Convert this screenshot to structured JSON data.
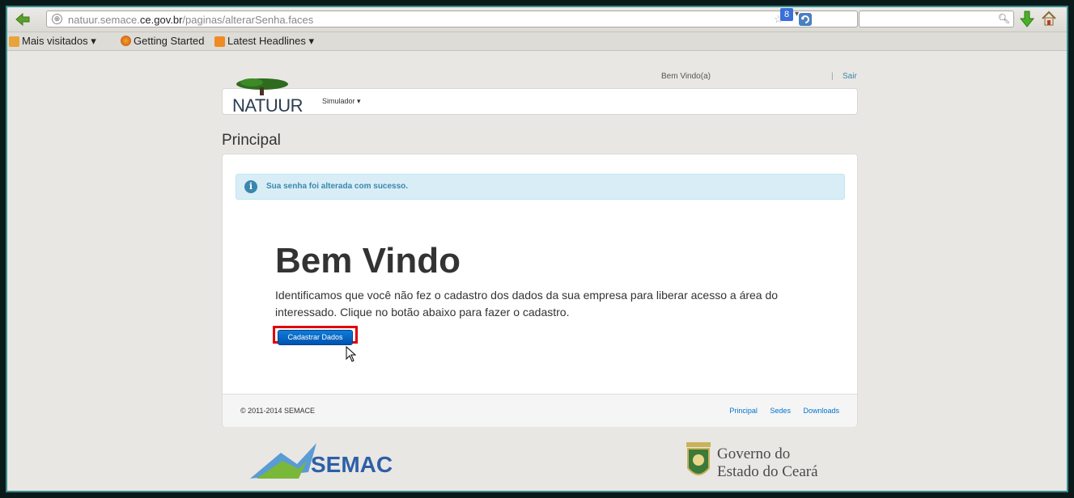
{
  "browser": {
    "url_prefix": "natuur.semace.",
    "url_domain": "ce.gov.br",
    "url_path": "/paginas/alterarSenha.faces",
    "search_engine_label": "8",
    "bookmarks": [
      {
        "label": "Mais visitados ▾",
        "icon": "folder-icon"
      },
      {
        "label": "Getting Started",
        "icon": "firefox-icon"
      },
      {
        "label": "Latest Headlines ▾",
        "icon": "rss-icon"
      }
    ]
  },
  "header": {
    "welcome": "Bem Vindo(a)",
    "separator": "|",
    "logout": "Sair"
  },
  "nav": {
    "logo_text": "NATUUR",
    "simulador": "Simulador ▾"
  },
  "page": {
    "title": "Principal",
    "alert": "Sua senha foi alterada com sucesso.",
    "hero_title": "Bem Vindo",
    "hero_text": "Identificamos que você não fez o cadastro dos dados da sua empresa para liberar acesso a área do interessado. Clique no botão abaixo para fazer o cadastro.",
    "cta_label": "Cadastrar Dados"
  },
  "footer": {
    "copyright": "© 2011-2014 SEMACE",
    "links": [
      "Principal",
      "Sedes",
      "Downloads"
    ]
  },
  "logos": {
    "semace": "SEMACE",
    "gov_line1": "Governo do",
    "gov_line2": "Estado do Ceará"
  },
  "colors": {
    "accent": "#0074cc",
    "alert_bg": "#d9edf7",
    "highlight": "#e00000"
  }
}
